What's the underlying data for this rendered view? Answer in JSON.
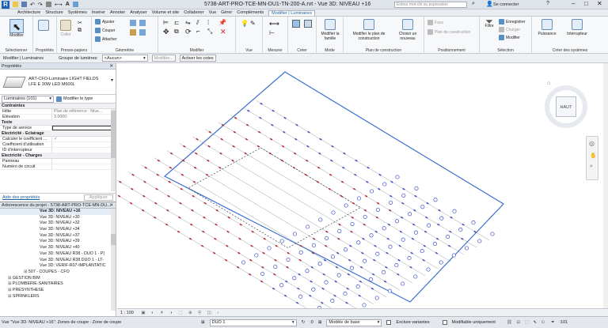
{
  "title_bar": {
    "document_title": "5738-ART-PRO-TCE-MN-DU1-TN-200-A.rvt - Vue 3D: NIVEAU +16",
    "search_placeholder": "Entrez mot-clé ou expression",
    "signin_label": "Se connecter"
  },
  "tabs": [
    "Architecture",
    "Structure",
    "Systèmes",
    "Insérer",
    "Annoter",
    "Analyser",
    "Volume et site",
    "Collaborer",
    "Vue",
    "Gérer",
    "Compléments",
    "Modifier | Luminaires"
  ],
  "ribbon": {
    "modify_label": "Modifier",
    "selection_label": "Sélectionner",
    "properties_label": "Propriétés",
    "clipboard_label": "Presse-papiers",
    "paste_label": "Coller",
    "geometry_label": "Géométrie",
    "geometry_items": [
      "Ajuster",
      "Couper",
      "Attacher"
    ],
    "modify_group_label": "Modifier",
    "view_label": "Vue",
    "measure_label": "Mesurer",
    "create_label": "Créer",
    "mode_btn": "Modifier la famille",
    "mode_label": "Mode",
    "workplane_btn": "Modifier le plan de construction",
    "workplane_btn2": "Choisir un nouveau",
    "workplane_label": "Plan de construction",
    "placement_items": [
      "Face",
      "Plan de construction"
    ],
    "placement_label": "Positionnement",
    "filter_label": "Filtre",
    "selection_items": [
      "Enregistrer",
      "Charger",
      "Modifier"
    ],
    "selection_group_label": "Sélection",
    "power_label": "Puissance",
    "switch_label": "Interrupteur",
    "systems_label": "Créer des systèmes"
  },
  "options_bar": {
    "context": "Modifier | Luminaires",
    "group_label": "Groupe de lumières:",
    "group_value": "<Aucun>",
    "modify_btn": "Modifier...",
    "dims_btn": "Activer les cotes"
  },
  "properties": {
    "header": "Propriétés",
    "type_name": "ART-CFO-Luminaire LIGHT FIELDS",
    "type_sub": "LFE E 30W LED M600L",
    "instance_combo": "Luminaires (101)",
    "edit_type": "Modifier le type",
    "sections": [
      {
        "name": "Contraintes",
        "rows": [
          [
            "Hôte",
            "Plan de référence : Nive..."
          ],
          [
            "Élévation",
            "3.0000"
          ]
        ]
      },
      {
        "name": "Texte",
        "rows": [
          [
            "Type de service",
            ""
          ]
        ]
      },
      {
        "name": "Electricité - Eclairage",
        "rows": [
          [
            "Calculer le coefficient ...",
            "✓"
          ],
          [
            "Coefficient d'utilisation",
            ""
          ],
          [
            "ID d'interrupteur",
            ""
          ]
        ]
      },
      {
        "name": "Electricité - Charges",
        "rows": [
          [
            "Panneau",
            ""
          ],
          [
            "Numéro de circuit",
            ""
          ]
        ]
      }
    ],
    "help_link": "Aide des propriétés",
    "apply_btn": "Appliquer"
  },
  "browser": {
    "header": "Arborescence du projet - 5738-ART-PRO-TCE-MN-DU...",
    "items": [
      "Vue 3D: NIVEAU +16",
      "Vue 3D: NIVEAU +30",
      "Vue 3D: NIVEAU +32",
      "Vue 3D: NIVEAU +34",
      "Vue 3D: NIVEAU +37",
      "Vue 3D: NIVEAU +39",
      "Vue 3D: NIVEAU +40",
      "Vue 3D: NIVEAU R38 - DUO 1 - P(",
      "Vue 3D: NIVEAU R38 DUO 1 - LT-",
      "Vue 3D: VERIF-R07-IMPLANTATIC",
      "507 - COUPES - CFO",
      "GESTION BIM",
      "PLOMBERIE-SANITAIRES",
      "PRESYNTHESE",
      "SPRINKLERS"
    ]
  },
  "viewcube": {
    "label": "HAUT"
  },
  "view_bar": {
    "scale": "1 : 100"
  },
  "status_bar": {
    "message": "Vue \"Vue 3D: NIVEAU +16\": Zones de coupe : Zone de coupe",
    "workset": "DUO 1",
    "model": "Modèle de base",
    "exclude_variants": "Exclure variantes",
    "editable_only": "Modifiable uniquement",
    "count": ":101"
  },
  "colors": {
    "accent": "#1b5f9d",
    "drawing_frame": "#3b6fd0",
    "fixture_blue": "#3a4fc8",
    "fixture_red": "#b3262a"
  }
}
